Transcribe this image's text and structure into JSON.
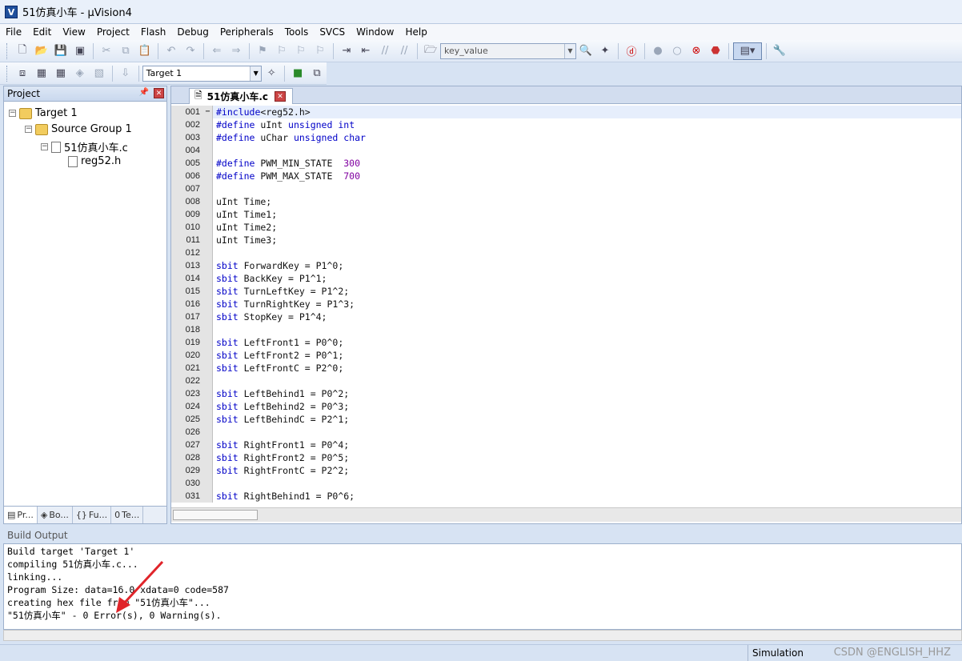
{
  "window": {
    "title": "51仿真小车  - µVision4"
  },
  "menu": [
    "File",
    "Edit",
    "View",
    "Project",
    "Flash",
    "Debug",
    "Peripherals",
    "Tools",
    "SVCS",
    "Window",
    "Help"
  ],
  "toolbar": {
    "find_combo_value": "key_value",
    "target_combo_value": "Target 1"
  },
  "project_panel": {
    "header": "Project",
    "tree": [
      {
        "label": "Target 1"
      },
      {
        "label": "Source Group 1"
      },
      {
        "label": "51仿真小车.c"
      },
      {
        "label": "reg52.h"
      }
    ],
    "tabs": [
      "Pr...",
      "Bo...",
      "Fu...",
      "Te..."
    ]
  },
  "editor": {
    "tab_label": "51仿真小车.c",
    "lines": [
      {
        "n": "001",
        "t": "#include<reg52.h>"
      },
      {
        "n": "002",
        "t": "#define uInt unsigned int"
      },
      {
        "n": "003",
        "t": "#define uChar unsigned char"
      },
      {
        "n": "004",
        "t": ""
      },
      {
        "n": "005",
        "t": "#define PWM_MIN_STATE  300"
      },
      {
        "n": "006",
        "t": "#define PWM_MAX_STATE  700"
      },
      {
        "n": "007",
        "t": ""
      },
      {
        "n": "008",
        "t": "uInt Time;"
      },
      {
        "n": "009",
        "t": "uInt Time1;"
      },
      {
        "n": "010",
        "t": "uInt Time2;"
      },
      {
        "n": "011",
        "t": "uInt Time3;"
      },
      {
        "n": "012",
        "t": ""
      },
      {
        "n": "013",
        "t": "sbit ForwardKey = P1^0;"
      },
      {
        "n": "014",
        "t": "sbit BackKey = P1^1;"
      },
      {
        "n": "015",
        "t": "sbit TurnLeftKey = P1^2;"
      },
      {
        "n": "016",
        "t": "sbit TurnRightKey = P1^3;"
      },
      {
        "n": "017",
        "t": "sbit StopKey = P1^4;"
      },
      {
        "n": "018",
        "t": ""
      },
      {
        "n": "019",
        "t": "sbit LeftFront1 = P0^0;"
      },
      {
        "n": "020",
        "t": "sbit LeftFront2 = P0^1;"
      },
      {
        "n": "021",
        "t": "sbit LeftFrontC = P2^0;"
      },
      {
        "n": "022",
        "t": ""
      },
      {
        "n": "023",
        "t": "sbit LeftBehind1 = P0^2;"
      },
      {
        "n": "024",
        "t": "sbit LeftBehind2 = P0^3;"
      },
      {
        "n": "025",
        "t": "sbit LeftBehindC = P2^1;"
      },
      {
        "n": "026",
        "t": ""
      },
      {
        "n": "027",
        "t": "sbit RightFront1 = P0^4;"
      },
      {
        "n": "028",
        "t": "sbit RightFront2 = P0^5;"
      },
      {
        "n": "029",
        "t": "sbit RightFrontC = P2^2;"
      },
      {
        "n": "030",
        "t": ""
      },
      {
        "n": "031",
        "t": "sbit RightBehind1 = P0^6;"
      }
    ]
  },
  "build_output": {
    "header": "Build Output",
    "lines": [
      "Build target 'Target 1'",
      "compiling 51仿真小车.c...",
      "linking...",
      "Program Size: data=16.0 xdata=0 code=587",
      "creating hex file from \"51仿真小车\"...",
      "\"51仿真小车\" - 0 Error(s), 0 Warning(s)."
    ]
  },
  "status": {
    "mode": "Simulation",
    "watermark": "CSDN @ENGLISH_HHZ"
  },
  "colors": {
    "keyword": "#0000c8",
    "number": "#8000a0",
    "arrow": "#e0242a"
  }
}
